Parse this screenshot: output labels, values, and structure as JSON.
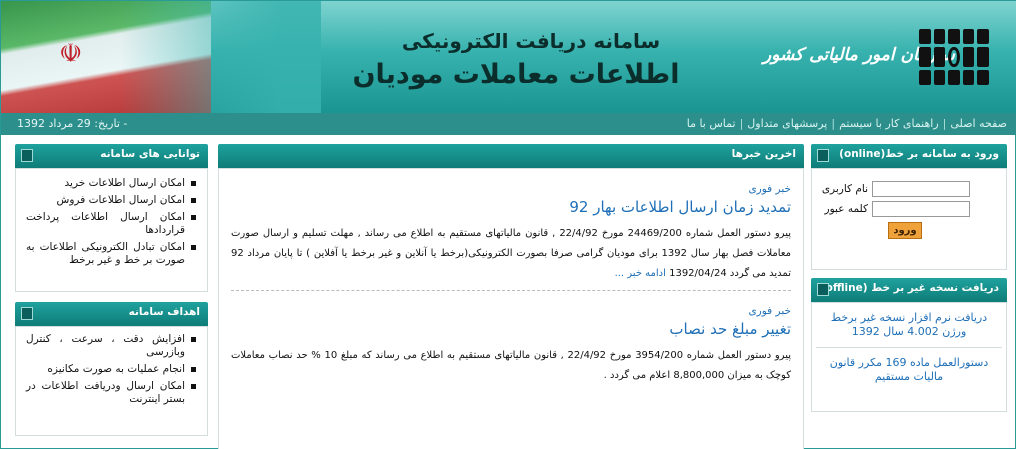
{
  "header": {
    "subtitle": "سامانه دریافت الکترونیکی",
    "title": "اطلاعات معاملات مودیان",
    "org_name": "سازمان امور مالیاتی کشور",
    "emblem_glyph": "☫",
    "flag_colors": [
      "#2f8e3e",
      "#ffffff",
      "#c22a2a"
    ]
  },
  "navbar": {
    "date_text": "- تاریخ: 29 مرداد 1392",
    "links": [
      "صفحه اصلی",
      "راهنمای کار با سیستم",
      "پرسشهای متداول",
      "تماس با ما"
    ]
  },
  "right": {
    "login": {
      "header": "ورود به سامانه بر خط(online)",
      "username_label": "نام کاربری",
      "username_value": "",
      "password_label": "کلمه عبور",
      "password_value": "",
      "button": "ورود"
    },
    "offline": {
      "header": "دریافت نسخه غیر بر خط (offline)",
      "link1": "دریافت نرم افزار نسخه غیر برخط ورژن 4.002 سال 1392",
      "link2": "دستورالعمل ماده 169 مکرر قانون مالیات مستقیم"
    }
  },
  "center": {
    "header": "اخرین خبرها",
    "news": [
      {
        "kicker": "خبر فوری",
        "title": "تمدید زمان ارسال اطلاعات بهار 92",
        "body": "پیرو دستور العمل شماره 24469/200 مورخ 22/4/92 , قانون مالیاتهای مستقیم به اطلاع می رساند , مهلت تسلیم و ارسال صورت معاملات فصل بهار سال 1392 برای مودیان گرامی صرفا بصورت الکترونیکی(برخط یا آنلاین و غیر برخط یا آفلاین ) تا پایان مرداد 92 تمدید می گردد  1392/04/24",
        "more": "ادامه خبر ..."
      },
      {
        "kicker": "خبر فوری",
        "title": "تغییر مبلغ حد نصاب",
        "body": "پیرو دستور العمل شماره 3954/200 مورخ 22/4/92 , قانون مالیاتهای مستقیم به اطلاع می رساند که مبلغ 10 % حد نصاب معاملات کوچک به میزان 8,800,000 اعلام می گردد ."
      }
    ]
  },
  "left": {
    "features": {
      "header": "توانایی های سامانه",
      "items": [
        "امکان ارسال اطلاعات خرید",
        "امکان ارسال اطلاعات فروش",
        "امکان ارسال اطلاعات پرداخت قراردادها",
        "امکان تبادل الکترونیکی اطلاعات به صورت بر خط و غیر برخط"
      ]
    },
    "goals": {
      "header": "اهداف سامانه",
      "items": [
        "افزایش دقت ، سرعت ، کنترل وبازرسی",
        "انجام عملیات به صورت مکانیزه",
        "امکان ارسال ودریافت اطلاعات در بستر اینترنت"
      ]
    }
  }
}
